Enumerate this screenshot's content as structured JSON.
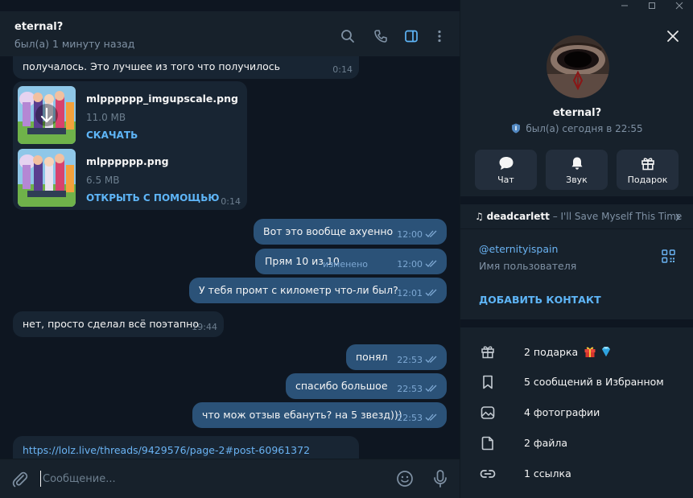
{
  "window": {
    "controls": [
      "minimize",
      "maximize",
      "close"
    ]
  },
  "chat": {
    "title": "eternal?",
    "status": "был(а) 1 минуту назад",
    "header_icons": [
      "search-icon",
      "phone-icon",
      "sidebar-toggle-icon",
      "more-icon"
    ],
    "messages": [
      {
        "dir": "in",
        "text": "получалось. Это лучшее из того что получилось",
        "time": "0:14"
      },
      {
        "dir": "in",
        "type": "files",
        "time": "0:14",
        "files": [
          {
            "name": "mlpppppp_imgupscale.png",
            "size": "11.0 MB",
            "action": "СКАЧАТЬ"
          },
          {
            "name": "mlpppppp.png",
            "size": "6.5 MB",
            "action": "ОТКРЫТЬ С ПОМОЩЬЮ"
          }
        ]
      },
      {
        "dir": "out",
        "text": "Вот это вообще ахуенно",
        "time": "12:00"
      },
      {
        "dir": "out",
        "text": "Прям 10 из 10",
        "edited": "изменено",
        "time": "12:00"
      },
      {
        "dir": "out",
        "text": "У тебя промт с километр что-ли был?",
        "time": "12:01"
      },
      {
        "dir": "in",
        "text": "нет, просто сделал всё поэтапно",
        "time": "19:44"
      },
      {
        "dir": "out",
        "text": "понял",
        "time": "22:53"
      },
      {
        "dir": "out",
        "text": "спасибо большое",
        "time": "22:53"
      },
      {
        "dir": "out",
        "text": "что мож отзыв ебануть? на 5 звезд)))",
        "time": "22:53"
      },
      {
        "dir": "in",
        "text": "https://lolz.live/threads/9429576/page-2#post-60961372"
      }
    ],
    "input_placeholder": "Сообщение..."
  },
  "panel": {
    "name": "eternal?",
    "status": "был(а) сегодня в 22:55",
    "buttons": [
      {
        "label": "Чат",
        "icon": "chat-icon"
      },
      {
        "label": "Звук",
        "icon": "bell-icon"
      },
      {
        "label": "Подарок",
        "icon": "gift-icon"
      }
    ],
    "music": {
      "artist": "deadcarlett",
      "separator": " – ",
      "track": "I'll Save Myself This Time"
    },
    "username": "@eternityispain",
    "username_label": "Имя пользователя",
    "add_contact": "ДОБАВИТЬ КОНТАКТ",
    "media": [
      {
        "label": "2 подарка",
        "icon": "gift-icon"
      },
      {
        "label": "5 сообщений в Избранном",
        "icon": "bookmark-icon"
      },
      {
        "label": "4 фотографии",
        "icon": "photo-icon"
      },
      {
        "label": "2 файла",
        "icon": "file-icon"
      },
      {
        "label": "1 ссылка",
        "icon": "link-icon"
      }
    ]
  },
  "colors": {
    "accent": "#5eb5f7",
    "outgoing": "#2b5278",
    "incoming": "#182533",
    "background": "#0e1621",
    "panel": "#17212b"
  }
}
